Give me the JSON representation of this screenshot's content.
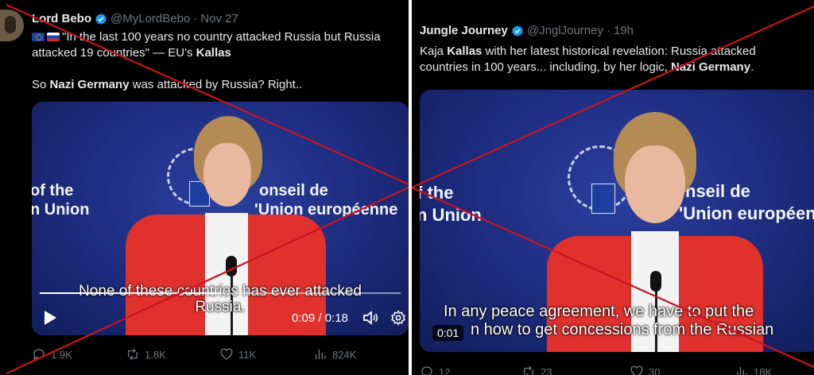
{
  "left_post": {
    "name": "Lord Bebo",
    "handle": "@MyLordBebo",
    "separator": "·",
    "date": "Nov 27",
    "line1": "\"In the last 100 years no country attacked Russia but Russia",
    "line2_pre": "attacked 19 countries\" — EU's ",
    "line2_bold": "Kallas",
    "line3_pre": "So ",
    "line3_bold": "Nazi Germany",
    "line3_post": " was attacked by Russia? Right..",
    "video": {
      "backdrop_line1": "of the",
      "backdrop_line2": "n Union",
      "backdrop_line3": "onseil de",
      "backdrop_line4": "'Union européenne",
      "subtitle_line1": "None of these countries has ever attacked",
      "subtitle_line2": "Russia.",
      "time": "0:09 / 0:18",
      "progress_fraction": 0.5
    },
    "stats": {
      "replies": "1.9K",
      "reposts": "1.8K",
      "likes": "11K",
      "views": "824K"
    }
  },
  "right_post": {
    "name": "Jungle Journey",
    "handle": "@JnglJourney",
    "separator": "·",
    "date": "19h",
    "line1_pre": "Kaja ",
    "line1_bold": "Kallas",
    "line1_post": " with her latest historical revelation: Russia attacked",
    "line2_pre": "countries in 100 years... including, by her logic, ",
    "line2_bold": "Nazi Germany",
    "line2_post": ".",
    "video": {
      "backdrop_line1": "f the",
      "backdrop_line2": "n Union",
      "backdrop_line3": "nseil de",
      "backdrop_line4": "'Union européenn",
      "subtitle_line1": "In any peace agreement, we have to put the",
      "subtitle_line2": "n how to get concessions from the Russian",
      "time": "0:01"
    },
    "stats": {
      "replies": "12",
      "reposts": "23",
      "likes": "30",
      "views": "18K"
    }
  },
  "colors": {
    "cross": "#c8141e",
    "verified": "#1d9bf0",
    "jacket": "#e0312d"
  }
}
